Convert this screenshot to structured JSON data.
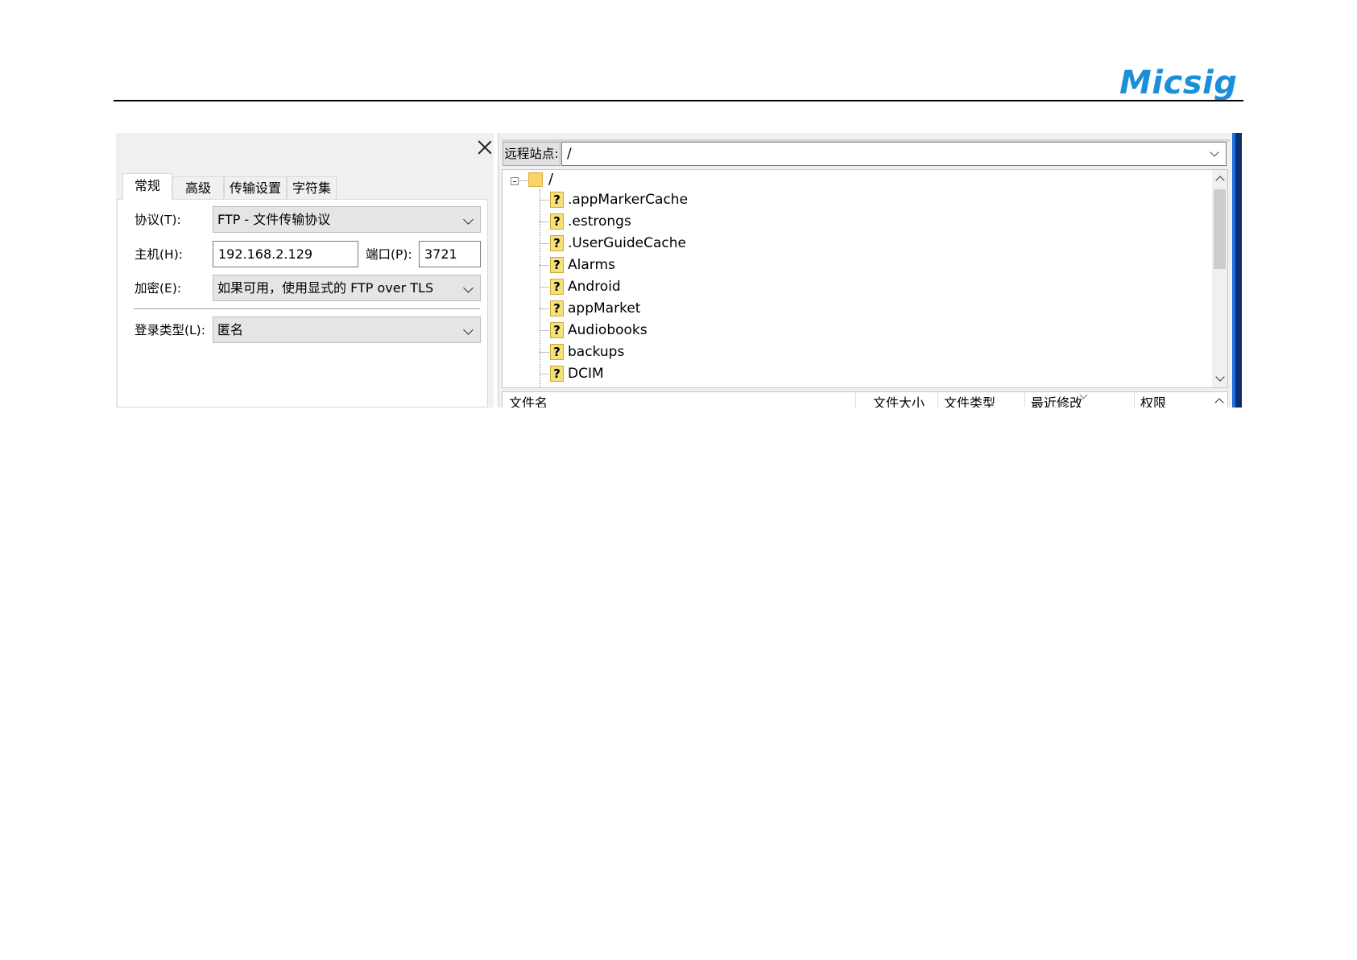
{
  "brand": {
    "logo_text": "Micsig",
    "color": "#1b8fd9"
  },
  "dialog": {
    "tabs": [
      {
        "label": "常规",
        "active": true
      },
      {
        "label": "高级",
        "active": false
      },
      {
        "label": "传输设置",
        "active": false
      },
      {
        "label": "字符集",
        "active": false
      }
    ],
    "protocol": {
      "label": "协议(T):",
      "value": "FTP - 文件传输协议"
    },
    "host": {
      "label": "主机(H):",
      "value": "192.168.2.129"
    },
    "port": {
      "label": "端口(P):",
      "value": "3721"
    },
    "encryption": {
      "label": "加密(E):",
      "value": "如果可用，使用显式的 FTP over TLS"
    },
    "login_type": {
      "label": "登录类型(L):",
      "value": "匿名"
    }
  },
  "remote": {
    "site_label": "远程站点:",
    "path": "/",
    "root": "/",
    "entries": [
      ".appMarkerCache",
      ".estrongs",
      ".UserGuideCache",
      "Alarms",
      "Android",
      "appMarket",
      "Audiobooks",
      "backups",
      "DCIM"
    ],
    "columns": [
      "文件名",
      "文件大小",
      "文件类型",
      "最近修改",
      "权限"
    ]
  }
}
